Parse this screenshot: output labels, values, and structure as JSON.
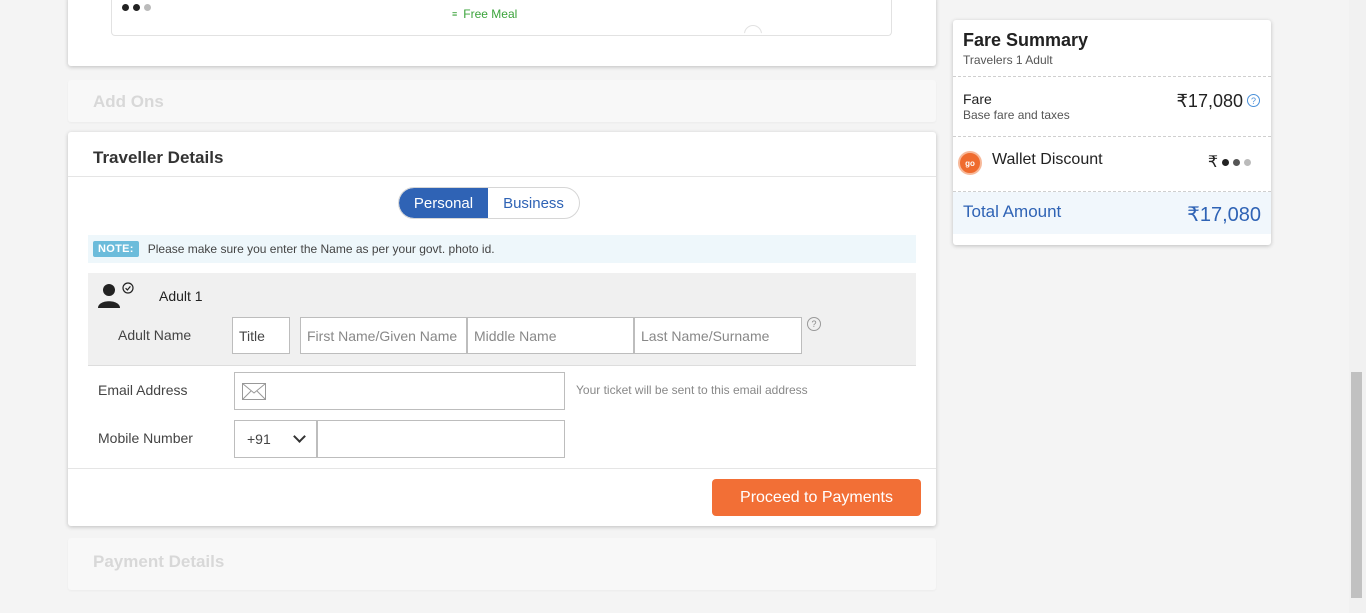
{
  "flight": {
    "meal_label": "Free Meal",
    "meal_icon": "meal-icon"
  },
  "addons": {
    "title": "Add Ons"
  },
  "traveller": {
    "title": "Traveller Details",
    "tabs": {
      "personal": "Personal",
      "business": "Business",
      "selected": "Personal"
    },
    "note": {
      "badge": "NOTE:",
      "text": "Please make sure you enter the Name as per your govt. photo id."
    },
    "adult": {
      "label": "Adult 1",
      "name_label": "Adult Name",
      "title_value": "Title",
      "first_placeholder": "First Name/Given Name",
      "middle_placeholder": "Middle Name",
      "last_placeholder": "Last Name/Surname",
      "help_glyph": "?"
    },
    "email": {
      "label": "Email Address",
      "value": "",
      "hint": "Your ticket will be sent to this email address"
    },
    "mobile": {
      "label": "Mobile Number",
      "country_code": "+91",
      "value": ""
    },
    "proceed_label": "Proceed to Payments"
  },
  "payment": {
    "title": "Payment Details"
  },
  "fare_summary": {
    "title": "Fare Summary",
    "travelers_label": "Travelers",
    "travelers_value": "1 Adult",
    "fare_label": "Fare",
    "fare_note": "Base fare and taxes",
    "fare_amount": "₹17,080",
    "help_glyph": "?",
    "wallet_icon_text": "go",
    "wallet_label": "Wallet Discount",
    "wallet_currency": "₹",
    "total_label": "Total Amount",
    "total_amount": "₹17,080"
  },
  "colors": {
    "primary_blue": "#2f63b5",
    "proceed_orange": "#f26f36",
    "meal_green": "#3aa33a"
  }
}
